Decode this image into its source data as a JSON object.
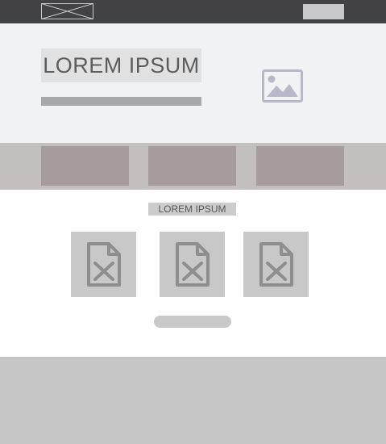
{
  "header": {
    "logo_icon": "image-placeholder-icon",
    "button_label": ""
  },
  "hero": {
    "title": "LOREM IPSUM",
    "image_icon": "image-icon"
  },
  "content": {
    "section_label": "LOREM IPSUM",
    "file_icon": "broken-file-icon",
    "button_label": ""
  },
  "colors": {
    "topbar": "#424244",
    "hero_bg": "#f1f2f4",
    "strip_bg": "#c2bfbc",
    "strip_block": "#a69c9c",
    "tile_bg": "#c8c8c8",
    "footer_bg": "#c6c6c6"
  }
}
